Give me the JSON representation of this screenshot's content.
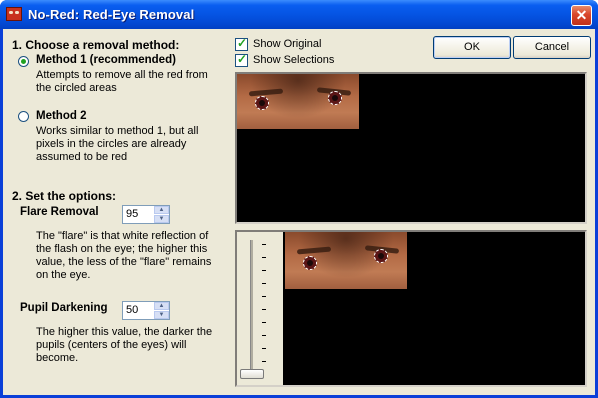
{
  "window": {
    "title": "No-Red: Red-Eye Removal",
    "close_glyph": "✕"
  },
  "left": {
    "section1": "1. Choose a removal method:",
    "method1": {
      "label": "Method 1 (recommended)",
      "desc": [
        "Attempts to remove all the red from",
        "the circled areas"
      ],
      "selected": true
    },
    "method2": {
      "label": "Method 2",
      "desc": [
        "Works similar to method 1, but all",
        "pixels in the circles are already",
        "assumed to be red"
      ],
      "selected": false
    },
    "section2": "2. Set the options:",
    "flare": {
      "label": "Flare Removal",
      "value": "95",
      "desc": [
        "The \"flare\" is that white reflection of",
        "the flash on the eye; the higher this",
        "value, the less of the \"flare\" remains",
        "on the eye."
      ]
    },
    "pupil": {
      "label": "Pupil Darkening",
      "value": "50",
      "desc": [
        "The higher this value, the darker the",
        "pupils (centers of the eyes) will",
        "become."
      ]
    }
  },
  "right": {
    "show_original": {
      "label": "Show Original",
      "checked": true
    },
    "show_selections": {
      "label": "Show Selections",
      "checked": true
    },
    "ok_label": "OK",
    "cancel_label": "Cancel"
  },
  "colors": {
    "titlebar": "#0554e3",
    "face": "#ece9d8",
    "accent": "#21a121"
  }
}
